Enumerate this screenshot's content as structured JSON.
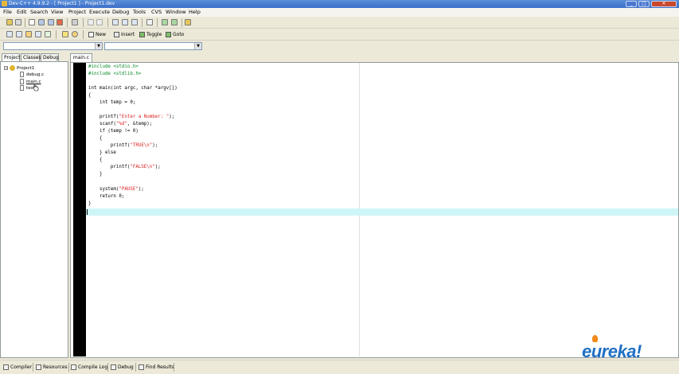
{
  "window": {
    "title": "Dev-C++ 4.9.9.2  -  [ Project1 ] - Project1.dev",
    "buttons": {
      "minimize": "_",
      "maximize": "□",
      "close": "✕"
    }
  },
  "menu": [
    "File",
    "Edit",
    "Search",
    "View",
    "Project",
    "Execute",
    "Debug",
    "Tools",
    "CVS",
    "Window",
    "Help"
  ],
  "toolbar": {
    "new_label": "New",
    "insert_label": "Insert",
    "toggle_label": "Toggle",
    "goto_label": "Goto"
  },
  "left_tabs": [
    "Project",
    "Classes",
    "Debug"
  ],
  "tree": {
    "root": "Project1",
    "files": [
      "debug.c",
      "main.c",
      "test"
    ]
  },
  "editor": {
    "tab": "main.c",
    "lines": [
      "#include <stdio.h>",
      "#include <stdlib.h>",
      "",
      "int main(int argc, char *argv[])",
      "{",
      "    int temp = 0;",
      "",
      "    printf(\"Enter a Number: \");",
      "    scanf(\"%d\", &temp);",
      "    if (temp != 0)",
      "    {",
      "        printf(\"TRUE\\n\");",
      "    } else",
      "    {",
      "        printf(\"FALSE\\n\");",
      "    }",
      "",
      "    system(\"PAUSE\");",
      "    return 0;",
      "}"
    ]
  },
  "bottom_tabs": [
    "Compiler",
    "Resources",
    "Compile Log",
    "Debug",
    "Find Results"
  ],
  "logo": {
    "text": "eureka!"
  },
  "colors": {
    "preprocessor": "#0a8a2a",
    "string": "#d22222",
    "current_line": "#cff6f7",
    "gutter": "#000000",
    "logo": "#1f6fc4"
  }
}
